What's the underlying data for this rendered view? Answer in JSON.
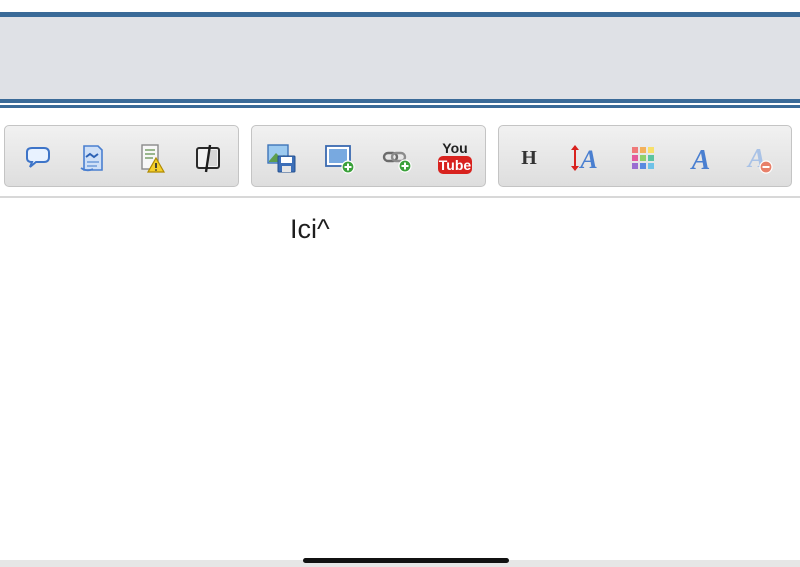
{
  "toolbar": {
    "groups": [
      {
        "buttons": [
          {
            "icon": "speech-bubble-icon"
          },
          {
            "icon": "document-edit-icon"
          },
          {
            "icon": "warning-document-icon"
          },
          {
            "icon": "spoiler-icon"
          }
        ]
      },
      {
        "buttons": [
          {
            "icon": "image-save-icon"
          },
          {
            "icon": "image-add-icon"
          },
          {
            "icon": "link-add-icon"
          },
          {
            "icon": "youtube-icon",
            "text_top": "You",
            "text_bottom": "Tube"
          }
        ]
      },
      {
        "buttons": [
          {
            "icon": "heading-icon",
            "text": "H"
          },
          {
            "icon": "font-size-icon",
            "text": "A"
          },
          {
            "icon": "color-palette-icon"
          },
          {
            "icon": "font-style-icon",
            "text": "A"
          },
          {
            "icon": "remove-format-icon",
            "text": "A"
          }
        ]
      }
    ]
  },
  "editor": {
    "content": "Ici^"
  },
  "colors": {
    "header_line": "#3a6a98",
    "header_band": "#dfe1e6",
    "youtube_red": "#d8221e",
    "icon_blue": "#4a7fd0"
  }
}
